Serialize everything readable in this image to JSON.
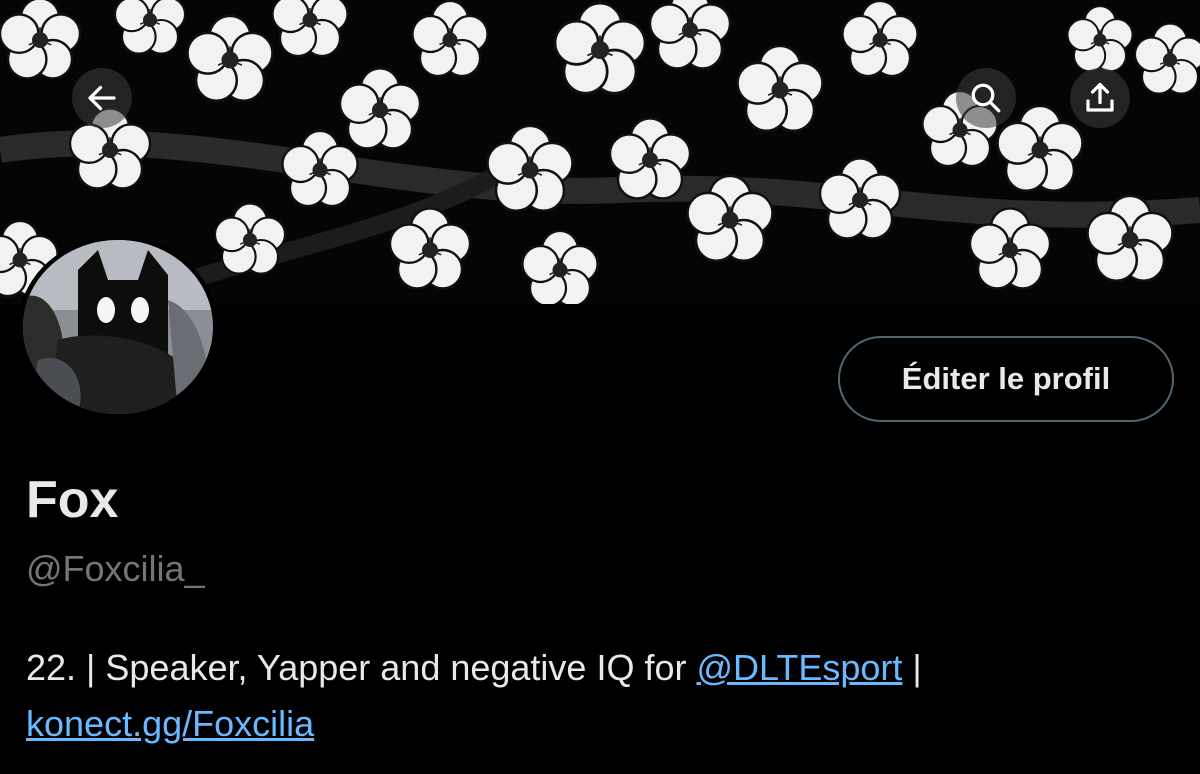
{
  "profile": {
    "display_name": "Fox",
    "handle": "@Foxcilia_",
    "edit_button_label": "Éditer le profil",
    "bio": {
      "prefix": "22. | Speaker, Yapper and negative IQ for ",
      "mention": "@DLTEsport",
      "separator": " |",
      "link": "konect.gg/Foxcilia"
    }
  },
  "icons": {
    "back": "arrow-left-icon",
    "search": "search-icon",
    "share": "share-icon"
  },
  "colors": {
    "background": "#000000",
    "text": "#e7e9ea",
    "secondary_text": "#71767b",
    "link": "#6ab8ff",
    "button_border": "#536471"
  }
}
